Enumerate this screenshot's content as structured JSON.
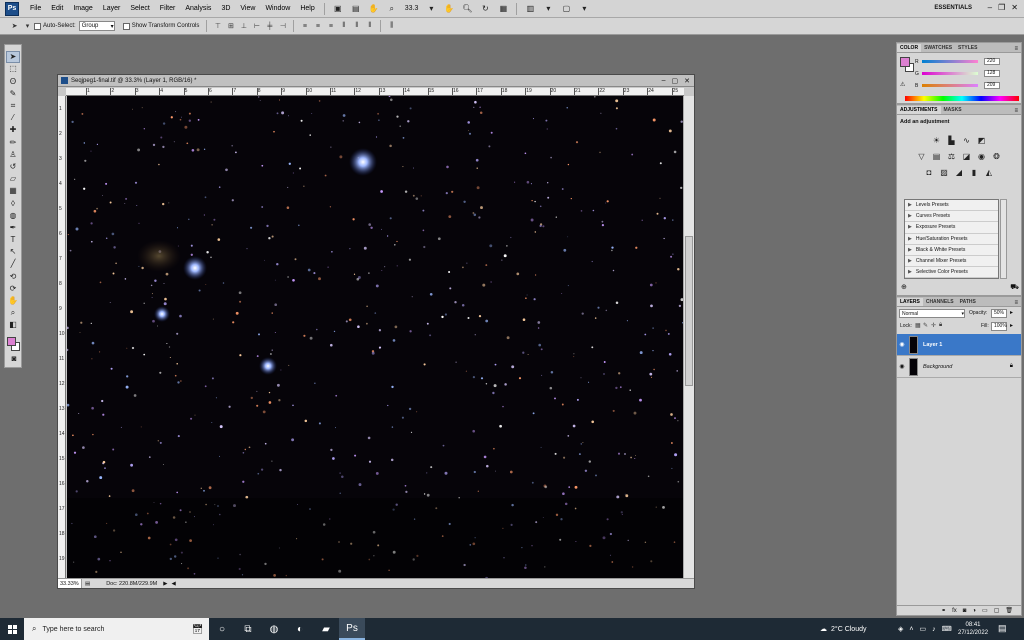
{
  "app": {
    "logo_text": "Ps",
    "menu": [
      "File",
      "Edit",
      "Image",
      "Layer",
      "Select",
      "Filter",
      "Analysis",
      "3D",
      "View",
      "Window",
      "Help"
    ],
    "zoom": "33.3",
    "workspace": "ESSENTIALS"
  },
  "options": {
    "auto_select_label": "Auto-Select:",
    "auto_select_value": "Group",
    "transform_label": "Show Transform Controls"
  },
  "document": {
    "title": "Seqjpeg1-final.tif @ 33.3% (Layer 1, RGB/16) *",
    "zoom_status": "33.33%",
    "doc_size": "Doc: 220.8M/229.9M",
    "ruler_top": [
      "1",
      "2",
      "3",
      "4",
      "5",
      "6",
      "7",
      "8",
      "9",
      "10",
      "11",
      "12",
      "13",
      "14",
      "15",
      "16",
      "17",
      "18",
      "19",
      "20",
      "21",
      "22",
      "23",
      "24",
      "25"
    ],
    "ruler_left": [
      "1",
      "2",
      "3",
      "4",
      "5",
      "6",
      "7",
      "8",
      "9",
      "10",
      "11",
      "12",
      "13",
      "14",
      "15",
      "16",
      "17",
      "18",
      "19"
    ]
  },
  "color_panel": {
    "tabs": [
      "COLOR",
      "SWATCHES",
      "STYLES"
    ],
    "fg_color": "#dc80d1",
    "channels": [
      {
        "label": "R",
        "value": "220"
      },
      {
        "label": "G",
        "value": "128"
      },
      {
        "label": "B",
        "value": "209"
      }
    ]
  },
  "adjustments_panel": {
    "tabs": [
      "ADJUSTMENTS",
      "MASKS"
    ],
    "title": "Add an adjustment",
    "presets": [
      "Levels Presets",
      "Curves Presets",
      "Exposure Presets",
      "Hue/Saturation Presets",
      "Black & White Presets",
      "Channel Mixer Presets",
      "Selective Color Presets"
    ]
  },
  "layers_panel": {
    "tabs": [
      "LAYERS",
      "CHANNELS",
      "PATHS"
    ],
    "blend_mode": "Normal",
    "opacity_label": "Opacity:",
    "opacity": "50%",
    "lock_label": "Lock:",
    "fill_label": "Fill:",
    "fill": "100%",
    "layers": [
      {
        "name": "Layer 1",
        "selected": true
      },
      {
        "name": "Background",
        "selected": false
      }
    ]
  },
  "taskbar": {
    "search_placeholder": "Type here to search",
    "weather": "2°C  Cloudy",
    "time": "08:41",
    "date": "27/12/2022"
  }
}
